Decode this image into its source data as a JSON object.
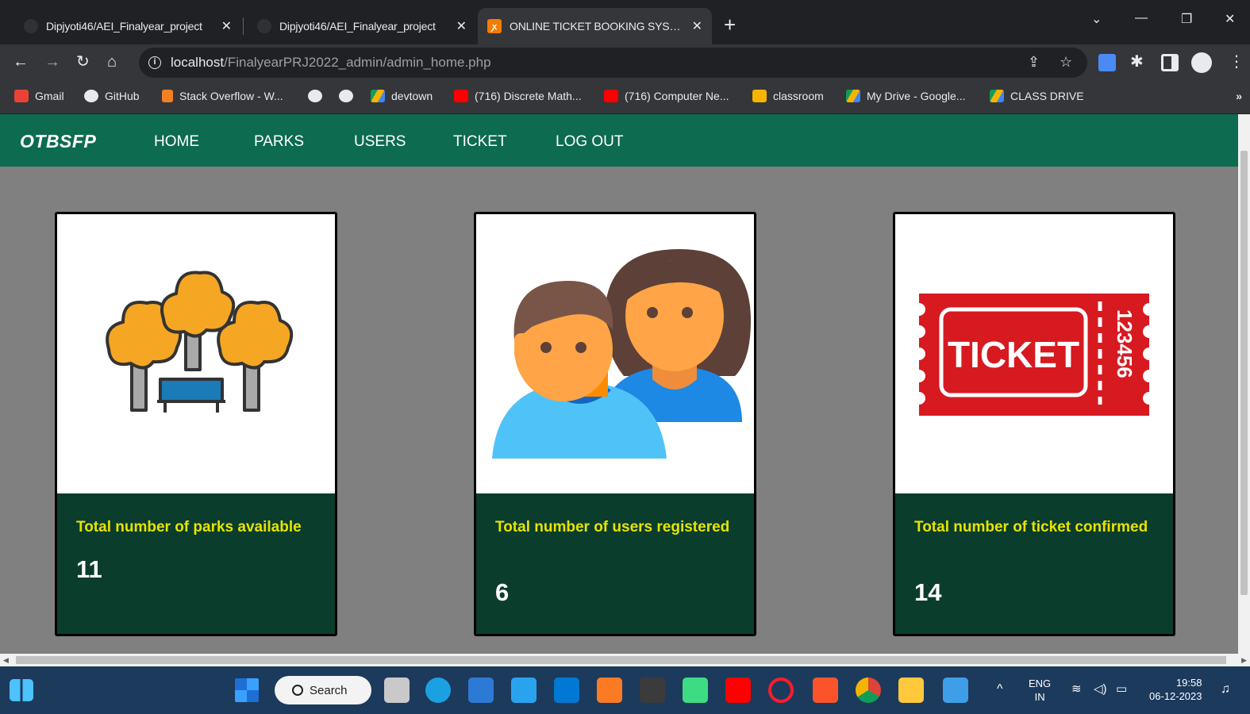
{
  "browser": {
    "tabs": [
      {
        "title": "Dipjyoti46/AEI_Finalyear_project",
        "active": false
      },
      {
        "title": "Dipjyoti46/AEI_Finalyear_project",
        "active": false
      },
      {
        "title": "ONLINE TICKET BOOKING SYSTEM",
        "active": true
      }
    ],
    "new_tab": "+",
    "url_host": "localhost",
    "url_path": "/FinalyearPRJ2022_admin/admin_home.php",
    "bookmarks": [
      {
        "label": "Gmail",
        "icon": "gmail-icon"
      },
      {
        "label": "GitHub",
        "icon": "github-icon"
      },
      {
        "label": "Stack Overflow - W...",
        "icon": "stackoverflow-icon"
      },
      {
        "label": "",
        "icon": "globe-icon"
      },
      {
        "label": "",
        "icon": "globe-icon"
      },
      {
        "label": "devtown",
        "icon": "drive-icon"
      },
      {
        "label": "(716) Discrete Math...",
        "icon": "youtube-icon"
      },
      {
        "label": "(716) Computer Ne...",
        "icon": "youtube-icon"
      },
      {
        "label": "classroom",
        "icon": "classroom-icon"
      },
      {
        "label": "My Drive - Google...",
        "icon": "drive-icon"
      },
      {
        "label": "CLASS DRIVE",
        "icon": "drive-icon"
      }
    ],
    "bookmarks_more": "»"
  },
  "app": {
    "brand": "OTBSFP",
    "nav": [
      "HOME",
      "PARKS",
      "USERS",
      "TICKET",
      "LOG OUT"
    ],
    "cards": [
      {
        "text": "Total number of parks available",
        "count": "11",
        "image": "parks-illustration"
      },
      {
        "text": "Total number of users registered",
        "count": "6",
        "image": "users-illustration"
      },
      {
        "text": "Total number of ticket confirmed",
        "count": "14",
        "image": "ticket-illustration"
      }
    ],
    "ticket_label": "TICKET",
    "ticket_number": "123456"
  },
  "taskbar": {
    "search": "Search",
    "lang": "ENG",
    "region": "IN",
    "time": "19:58",
    "date": "06-12-2023"
  },
  "colors": {
    "nav_green": "#0d6b4f",
    "card_footer": "#0b3d2c",
    "card_text": "#e6e300",
    "page_bg": "#808080"
  }
}
